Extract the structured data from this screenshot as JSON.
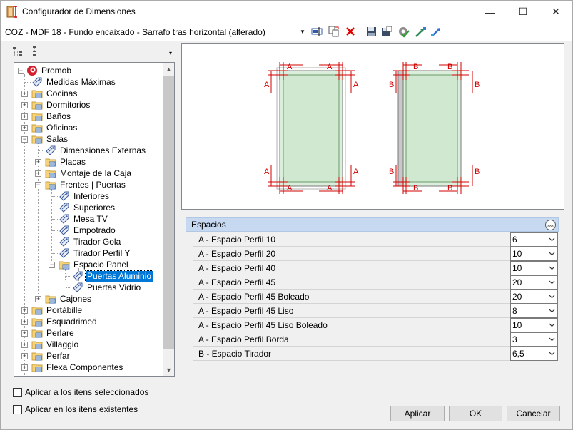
{
  "window": {
    "title": "Configurador de Dimensiones",
    "minimize": "—",
    "maximize": "☐",
    "close": "✕"
  },
  "toolbar": {
    "config_value": "COZ - MDF 18 - Fundo encaixado - Sarrafo tras horizontal (alterado)"
  },
  "tree": {
    "root": "Promob",
    "items": [
      {
        "label": "Medidas Máximas"
      },
      {
        "label": "Cocinas"
      },
      {
        "label": "Dormitorios"
      },
      {
        "label": "Baños"
      },
      {
        "label": "Oficinas"
      },
      {
        "label": "Salas"
      },
      {
        "label": "Dimensiones Externas"
      },
      {
        "label": "Placas"
      },
      {
        "label": "Montaje de la Caja"
      },
      {
        "label": "Frentes | Puertas"
      },
      {
        "label": "Inferiores"
      },
      {
        "label": "Superiores"
      },
      {
        "label": "Mesa TV"
      },
      {
        "label": "Empotrado"
      },
      {
        "label": "Tirador Gola"
      },
      {
        "label": "Tirador Perfil Y"
      },
      {
        "label": "Espacio Panel"
      },
      {
        "label": "Puertas Aluminio"
      },
      {
        "label": "Puertas Vidrio"
      },
      {
        "label": "Cajones"
      },
      {
        "label": "Portábille"
      },
      {
        "label": "Esquadrimed"
      },
      {
        "label": "Perlare"
      },
      {
        "label": "Villaggio"
      },
      {
        "label": "Perfar"
      },
      {
        "label": "Flexa Componentes"
      }
    ],
    "selected": "Puertas Aluminio"
  },
  "options": {
    "apply_selected": "Aplicar a los itens seleccionados",
    "apply_existing": "Aplicar en los itens existentes"
  },
  "preview": {
    "label_a": "A",
    "label_b": "B"
  },
  "spaces": {
    "title": "Espacios",
    "rows": [
      {
        "label": "A - Espacio Perfil 10",
        "value": "6"
      },
      {
        "label": "A - Espacio Perfil 20",
        "value": "10"
      },
      {
        "label": "A - Espacio Perfil 40",
        "value": "10"
      },
      {
        "label": "A - Espacio Perfil 45",
        "value": "20"
      },
      {
        "label": "A - Espacio Perfil 45 Boleado",
        "value": "20"
      },
      {
        "label": "A - Espacio Perfil 45 Liso",
        "value": "8"
      },
      {
        "label": "A - Espacio Perfil 45 Liso Boleado",
        "value": "10"
      },
      {
        "label": "A - Espacio Perfil Borda",
        "value": "3"
      },
      {
        "label": "B - Espacio Tirador",
        "value": "6,5"
      }
    ]
  },
  "buttons": {
    "apply": "Aplicar",
    "ok": "OK",
    "cancel": "Cancelar"
  }
}
